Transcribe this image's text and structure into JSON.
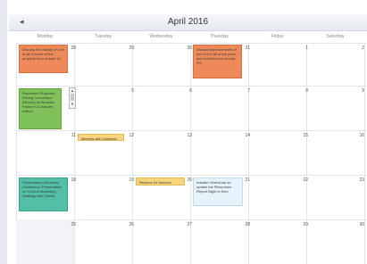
{
  "calendar": {
    "title": "April 2016",
    "prev_icon": "left-arrow-icon",
    "weekdays": [
      "Monday",
      "Tuesday",
      "Wednesday",
      "Thursday",
      "Friday",
      "Saturday"
    ],
    "weeks": [
      [
        "28",
        "29",
        "30",
        "31",
        "1",
        "2",
        "3"
      ],
      [
        "4",
        "5",
        "6",
        "7",
        "8",
        "9",
        "10"
      ],
      [
        "11",
        "12",
        "13",
        "14",
        "15",
        "16",
        "17"
      ],
      [
        "18",
        "19",
        "20",
        "21",
        "22",
        "23",
        "24"
      ],
      [
        "25",
        "26",
        "27",
        "28",
        "29",
        "30",
        "1"
      ]
    ],
    "events": [
      {
        "text": "Discuss the validity of Cell in all of some of the property from of April 14",
        "color": "#ee8a5a"
      },
      {
        "text": "Discuss improvements of the Cell in all of the price and conditions to accept 5%",
        "color": "#ee8a5a"
      },
      {
        "text": "Represent Proposed Pricing Convention (Report) on Browser Power in Computer edition",
        "color": "#7fc25a"
      },
      {
        "text": "Meeting with Quarterly Marketing",
        "color": "#f6d57c"
      },
      {
        "text": "Presentation Workshop Conference Presentation on Current Marketing Strategy with Clients",
        "color": "#52bfa6"
      },
      {
        "text": "Reserve for lunches",
        "color": "#f6d57c"
      },
      {
        "text": "Installer Workshop on update the Resources Report Night in Kiev",
        "color": "#e6f3fb"
      }
    ]
  }
}
